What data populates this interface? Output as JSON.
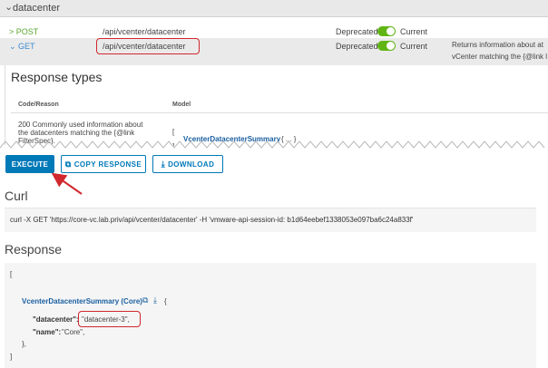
{
  "header": {
    "section_label": "datacenter"
  },
  "endpoints": {
    "post": {
      "method": "POST",
      "path": "/api/vcenter/datacenter",
      "deprecated_label": "Deprecated",
      "current_label": "Current"
    },
    "get": {
      "method": "GET",
      "path": "/api/vcenter/datacenter",
      "deprecated_label": "Deprecated",
      "current_label": "Current",
      "description_line1": "Returns information about at",
      "description_line2": "vCenter matching the {@link l"
    }
  },
  "response_types": {
    "title": "Response types",
    "col_code": "Code/Reason",
    "col_model": "Model",
    "row_code_line1": "200 Commonly used information about",
    "row_code_line2": "the datacenters matching the {@link",
    "row_code_line3": "FilterSpec}.",
    "row_model_bracket": "[",
    "row_model_close": "]",
    "row_model_name": "VcenterDatacenterSummary",
    "row_model_rest": "{ ... }"
  },
  "actions": {
    "execute_label": "EXECUTE",
    "copy_label": "COPY RESPONSE",
    "download_label": "DOWNLOAD"
  },
  "curl": {
    "title": "Curl",
    "command": "curl -X GET 'https://core-vc.lab.priv/api/vcenter/datacenter' -H 'vmware-api-session-id: b1d64eebef1338053e097ba6c24a833f'"
  },
  "response": {
    "title": "Response",
    "open_bracket": "[",
    "type_name": "VcenterDatacenterSummary (Core)",
    "open_brace": "{",
    "key1": "\"datacenter\":",
    "val1": "\"datacenter-3\",",
    "key2": "\"name\":",
    "val2": "\"Core\",",
    "close_brace": "},",
    "close_bracket": "]"
  },
  "colors": {
    "accent": "#0079b8",
    "annotation": "#d0282e",
    "toggle_on": "#60b515",
    "post_verb": "#5aa72d",
    "get_verb": "#3a8bd0"
  }
}
